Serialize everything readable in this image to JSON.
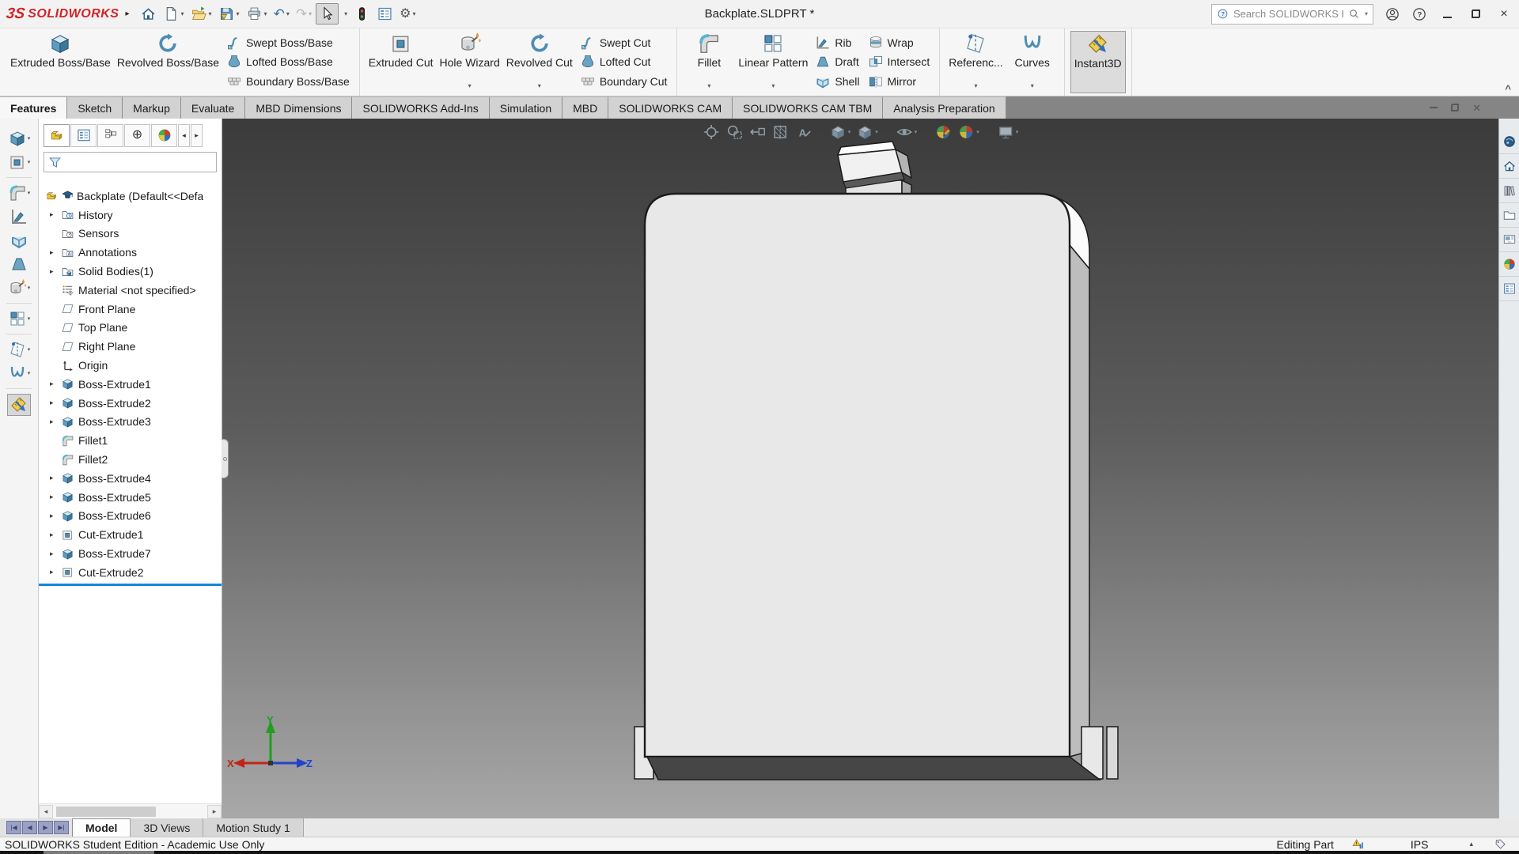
{
  "window": {
    "title": "Backplate.SLDPRT *",
    "brand": "SOLIDWORKS",
    "brand_glyph": "3S",
    "flyout_glyph": "▸"
  },
  "search": {
    "placeholder": "Search SOLIDWORKS Help"
  },
  "quick_access_icons": [
    "home",
    "new-document",
    "open",
    "save",
    "print",
    "undo",
    "redo",
    "select-cursor",
    "performance-light",
    "display-pane",
    "options-gear"
  ],
  "ribbon": {
    "collapse_glyph": "^",
    "groups": [
      {
        "big": [
          {
            "label": "Extruded Boss/Base"
          },
          {
            "label": "Revolved Boss/Base"
          }
        ],
        "small": [
          {
            "label": "Swept Boss/Base"
          },
          {
            "label": "Lofted Boss/Base"
          },
          {
            "label": "Boundary Boss/Base"
          }
        ]
      },
      {
        "big": [
          {
            "label": "Extruded Cut"
          },
          {
            "label": "Hole Wizard"
          },
          {
            "label": "Revolved Cut"
          }
        ],
        "small": [
          {
            "label": "Swept Cut"
          },
          {
            "label": "Lofted Cut"
          },
          {
            "label": "Boundary Cut"
          }
        ]
      },
      {
        "big": [
          {
            "label": "Fillet"
          },
          {
            "label": "Linear Pattern"
          }
        ],
        "small": [
          {
            "label": "Rib"
          },
          {
            "label": "Draft"
          },
          {
            "label": "Shell"
          }
        ],
        "small2": [
          {
            "label": "Wrap"
          },
          {
            "label": "Intersect"
          },
          {
            "label": "Mirror"
          }
        ]
      },
      {
        "big": [
          {
            "label": "Referenc..."
          },
          {
            "label": "Curves"
          }
        ]
      },
      {
        "big": [
          {
            "label": "Instant3D"
          }
        ]
      }
    ]
  },
  "tabs": {
    "active": "Features",
    "items": [
      {
        "label": "Features"
      },
      {
        "label": "Sketch"
      },
      {
        "label": "Markup"
      },
      {
        "label": "Evaluate"
      },
      {
        "label": "MBD Dimensions"
      },
      {
        "label": "SOLIDWORKS Add-Ins"
      },
      {
        "label": "Simulation"
      },
      {
        "label": "MBD"
      },
      {
        "label": "SOLIDWORKS CAM"
      },
      {
        "label": "SOLIDWORKS CAM TBM"
      },
      {
        "label": "Analysis Preparation"
      }
    ]
  },
  "tree": {
    "root": {
      "label": "Backplate (Default<<Defa"
    },
    "items": [
      {
        "label": "History"
      },
      {
        "label": "Sensors"
      },
      {
        "label": "Annotations"
      },
      {
        "label": "Solid Bodies(1)"
      },
      {
        "label": "Material <not specified>"
      },
      {
        "label": "Front Plane"
      },
      {
        "label": "Top Plane"
      },
      {
        "label": "Right Plane"
      },
      {
        "label": "Origin"
      },
      {
        "label": "Boss-Extrude1"
      },
      {
        "label": "Boss-Extrude2"
      },
      {
        "label": "Boss-Extrude3"
      },
      {
        "label": "Fillet1"
      },
      {
        "label": "Fillet2"
      },
      {
        "label": "Boss-Extrude4"
      },
      {
        "label": "Boss-Extrude5"
      },
      {
        "label": "Boss-Extrude6"
      },
      {
        "label": "Cut-Extrude1"
      },
      {
        "label": "Boss-Extrude7"
      },
      {
        "label": "Cut-Extrude2"
      }
    ]
  },
  "viewport": {
    "triad": {
      "x": "X",
      "y": "Y",
      "z": "Z"
    },
    "hud_icons": [
      "zoom-to-fit",
      "zoom-to-area",
      "previous-view",
      "section-view",
      "hide-show-annotations",
      "view-orientation",
      "display-style",
      "hide-show-items",
      "edit-appearance",
      "apply-scene",
      "view-settings"
    ]
  },
  "task_pane_icons": [
    "3dexperience",
    "home",
    "design-library",
    "file-explorer",
    "view-palette",
    "appearances-scenes",
    "custom-properties"
  ],
  "bottom_tabs": {
    "active": "Model",
    "items": [
      {
        "label": "Model"
      },
      {
        "label": "3D Views"
      },
      {
        "label": "Motion Study 1"
      }
    ]
  },
  "statusbar": {
    "left": "SOLIDWORKS Student Edition - Academic Use Only",
    "mode": "Editing Part",
    "units": "IPS",
    "units_caret": "▴"
  },
  "colors": {
    "rollback_bar": "#1287d8",
    "accent_blue": "#4f8cb3",
    "part_yellow": "#ecc63d",
    "viewport_top": "#3b3b3b",
    "viewport_bottom": "#a8a8a8"
  }
}
